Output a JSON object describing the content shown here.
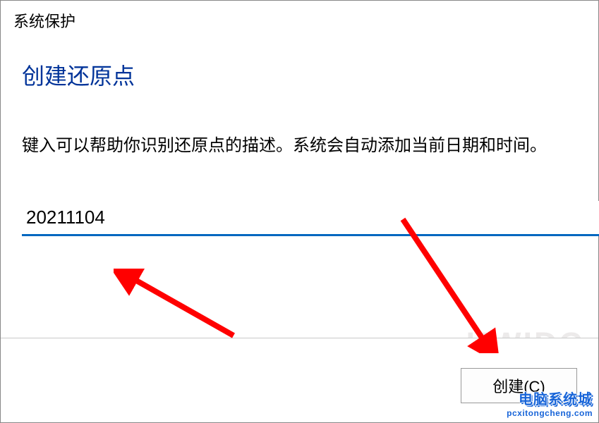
{
  "window": {
    "title": "系统保护"
  },
  "heading": "创建还原点",
  "description": "键入可以帮助你识别还原点的描述。系统会自动添加当前日期和时间。",
  "input": {
    "value": "20211104"
  },
  "buttons": {
    "create": "创建(C)"
  },
  "watermark": {
    "bg": "HWIDC",
    "cn": "电脑系统城",
    "en": "pcxitongcheng.com"
  },
  "annotations": {
    "arrow1_color": "#ff0000",
    "arrow2_color": "#ff0000"
  }
}
